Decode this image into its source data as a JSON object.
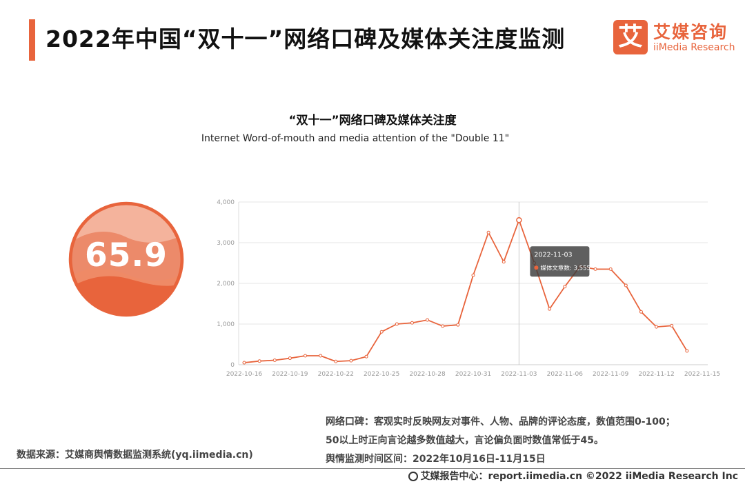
{
  "header": {
    "title": "2022年中国“双十一”网络口碑及媒体关注度监测",
    "logo_mark": "艾",
    "logo_cn": "艾媒咨询",
    "logo_en": "iiMedia Research"
  },
  "gauge": {
    "value": "65.9",
    "color": "#e8643c"
  },
  "chart_data": {
    "type": "line",
    "title": "“双十一”网络口碑及媒体关注度",
    "subtitle": "Internet Word-of-mouth and media attention of the \"Double 11\"",
    "x": [
      "2022-10-16",
      "2022-10-17",
      "2022-10-18",
      "2022-10-19",
      "2022-10-20",
      "2022-10-21",
      "2022-10-22",
      "2022-10-23",
      "2022-10-24",
      "2022-10-25",
      "2022-10-26",
      "2022-10-27",
      "2022-10-28",
      "2022-10-29",
      "2022-10-30",
      "2022-10-31",
      "2022-11-01",
      "2022-11-02",
      "2022-11-03",
      "2022-11-04",
      "2022-11-05",
      "2022-11-06",
      "2022-11-07",
      "2022-11-08",
      "2022-11-09",
      "2022-11-10",
      "2022-11-11",
      "2022-11-12",
      "2022-11-13",
      "2022-11-14",
      "2022-11-15"
    ],
    "x_tick_labels": [
      "2022-10-16",
      "2022-10-19",
      "2022-10-22",
      "2022-10-25",
      "2022-10-28",
      "2022-10-31",
      "2022-11-03",
      "2022-11-06",
      "2022-11-09",
      "2022-11-12",
      "2022-11-15"
    ],
    "series": [
      {
        "name": "媒体文章数",
        "values": [
          50,
          90,
          110,
          160,
          220,
          220,
          80,
          100,
          200,
          810,
          1000,
          1030,
          1100,
          950,
          980,
          2200,
          3250,
          2530,
          3555,
          2500,
          1370,
          1920,
          2420,
          2350,
          2350,
          1950,
          1300,
          930,
          960,
          340
        ]
      }
    ],
    "ylim": [
      0,
      4000
    ],
    "y_ticks": [
      "0",
      "1,000",
      "2,000",
      "3,000",
      "4,000"
    ],
    "grid": true,
    "line_color": "#e8643c",
    "tooltip": {
      "date": "2022-11-03",
      "label": "媒体文章数: 3,555"
    }
  },
  "notes": {
    "line1": "网络口碑：客观实时反映网友对事件、人物、品牌的评论态度，数值范围0-100；",
    "line2": "50以上时正向言论越多数值越大，言论偏负面时数值常低于45。",
    "line3": "舆情监测时间区间：2022年10月16日-11月15日"
  },
  "source": "数据来源：艾媒商舆情数据监测系统(yq.iimedia.cn)",
  "footer": "艾媒报告中心：report.iimedia.cn  ©2022  iiMedia Research  Inc"
}
